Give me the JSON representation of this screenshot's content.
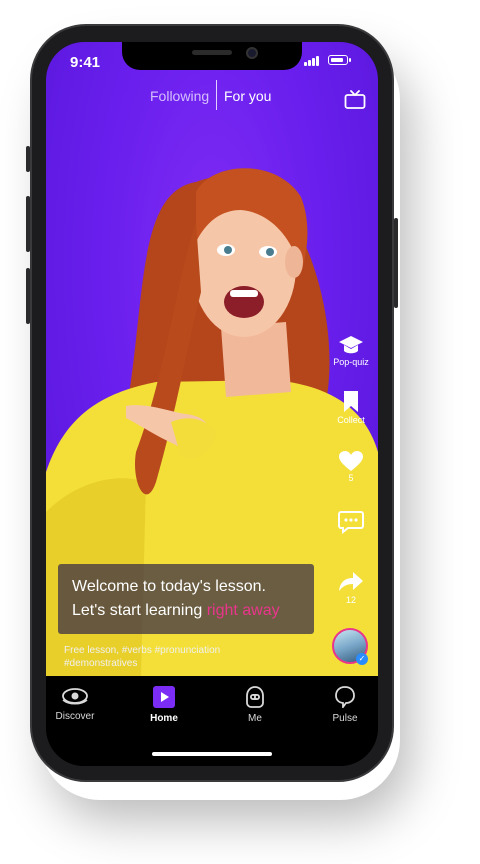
{
  "status_bar": {
    "time": "9:41",
    "battery_level": 0.9
  },
  "top_tabs": {
    "following": "Following",
    "for_you": "For you",
    "active": "for_you"
  },
  "side_actions": [
    {
      "icon": "graduation-cap-icon",
      "label": "Pop-quiz"
    },
    {
      "icon": "bookmark-icon",
      "label": "Collect"
    },
    {
      "icon": "heart-icon",
      "label": "5"
    },
    {
      "icon": "comment-icon",
      "label": ""
    },
    {
      "icon": "share-icon",
      "label": "12"
    }
  ],
  "caption": {
    "line1": "Welcome to today's lesson.",
    "line2_prefix": "Let's start learning ",
    "line2_highlight": "right away"
  },
  "tags": {
    "line1": "Free lesson, #verbs #pronunciation",
    "line2": "#demonstratives"
  },
  "nav": [
    {
      "icon": "eye-icon",
      "label": "Discover"
    },
    {
      "icon": "play-icon",
      "label": "Home"
    },
    {
      "icon": "robot-icon",
      "label": "Me"
    },
    {
      "icon": "chat-bubble-icon",
      "label": "Pulse"
    }
  ],
  "colors": {
    "accent": "#e9368b",
    "brand_purple": "#7f2cf3",
    "nav_bg": "#000000"
  }
}
